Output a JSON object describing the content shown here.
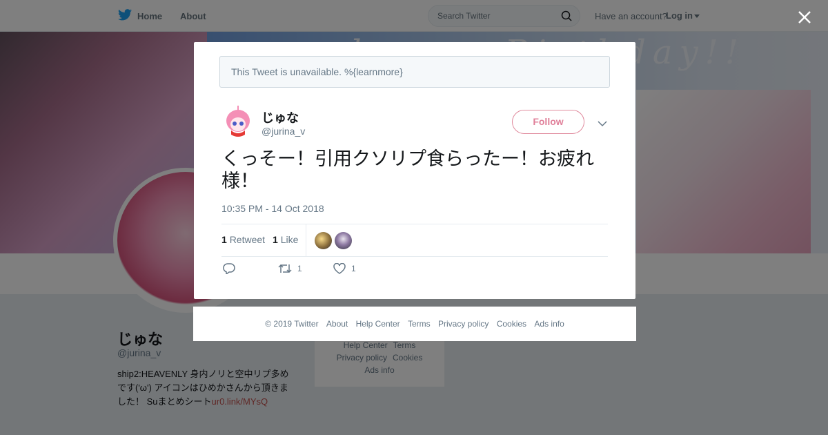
{
  "topbar": {
    "home_label": "Home",
    "about_label": "About",
    "search_placeholder": "Search Twitter",
    "have_account": "Have an account?",
    "login_label": "Log in"
  },
  "banner": {
    "text": "happy Birthday!!"
  },
  "profile": {
    "name": "じゅな",
    "handle": "@jurina_v",
    "bio": "ship2:HEAVENLY 身内ノリと空中リプ多めです('ω') アイコンはひめかさんから頂きました！ Suまとめシート",
    "bio_link": "ur0.link/MYsQ"
  },
  "side_links": {
    "help_center": "Help Center",
    "terms": "Terms",
    "privacy": "Privacy policy",
    "cookies": "Cookies",
    "ads_info": "Ads info"
  },
  "modal": {
    "unavailable_notice": "This Tweet is unavailable. %{learnmore}",
    "tweet": {
      "name": "じゅな",
      "handle": "@jurina_v",
      "follow_label": "Follow",
      "text": "くっそー！引用クソリプ食らったー！お疲れ様！",
      "timestamp": "10:35 PM - 14 Oct 2018",
      "retweet_count": "1",
      "retweet_label": "Retweet",
      "like_count": "1",
      "like_label": "Like",
      "action_retweet_count": "1",
      "action_like_count": "1"
    }
  },
  "footer": {
    "copyright": "© 2019 Twitter",
    "about": "About",
    "help_center": "Help Center",
    "terms": "Terms",
    "privacy": "Privacy policy",
    "cookies": "Cookies",
    "ads_info": "Ads info"
  },
  "colors": {
    "accent": "#1da1f2",
    "follow": "#e0809a",
    "muted": "#657786"
  }
}
